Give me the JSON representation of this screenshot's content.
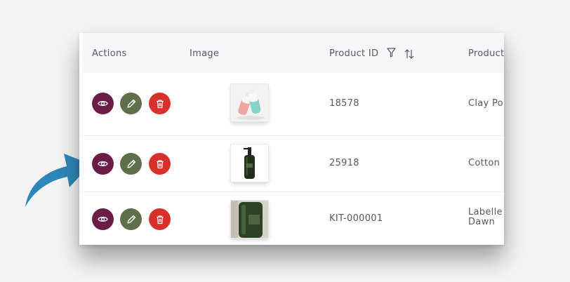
{
  "table": {
    "columns": [
      {
        "label": "Actions"
      },
      {
        "label": "Image"
      },
      {
        "label": "Product ID"
      },
      {
        "label": "Product"
      }
    ],
    "rows": [
      {
        "product_id": "18578",
        "product_name": "Clay Po",
        "image": "cosmetic-bottles-thumbnail"
      },
      {
        "product_id": "25918",
        "product_name": "Cotton",
        "image": "soap-pump-bottle-thumbnail"
      },
      {
        "product_id": "KIT-000001",
        "product_name": "Labelle\nDawn",
        "image": "green-bottle-thumbnail"
      }
    ]
  },
  "icons": {
    "filter": "filter-icon",
    "sort": "sort-icon",
    "view": "eye-icon",
    "edit": "pencil-icon",
    "delete": "trash-icon",
    "annotation": "curved-arrow-icon"
  },
  "colors": {
    "view_button": "#6b1d47",
    "edit_button": "#5e7049",
    "delete_button": "#d8312b",
    "annotation_arrow": "#2f86b8"
  }
}
